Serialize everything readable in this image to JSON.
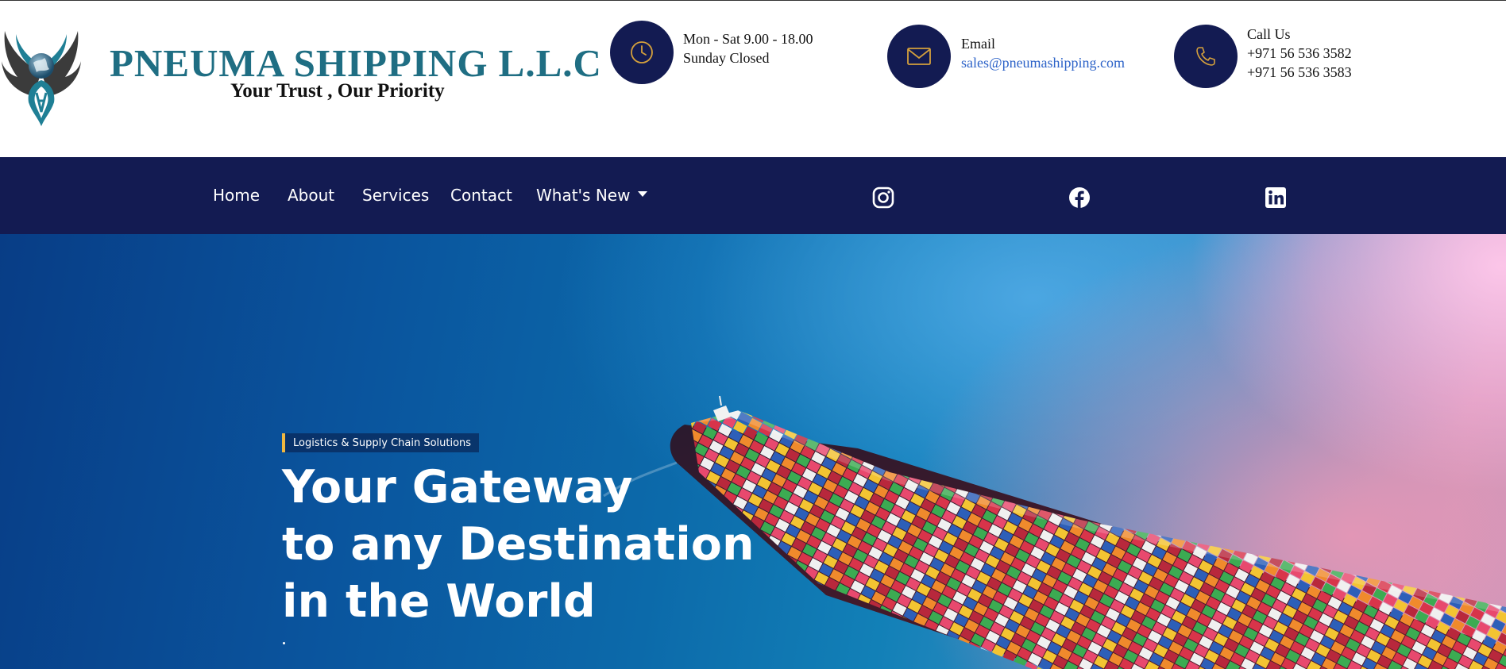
{
  "brand": {
    "name": "PNEUMA SHIPPING L.L.C",
    "tagline": "Your Trust , Our Priority"
  },
  "contact_info": {
    "hours": {
      "line1": "Mon - Sat 9.00 - 18.00",
      "line2": "Sunday Closed",
      "icon": "clock-icon"
    },
    "email": {
      "label": "Email",
      "address": "sales@pneumashipping.com",
      "icon": "mail-icon"
    },
    "phone": {
      "label": "Call Us",
      "number1": "+971 56 536 3582",
      "number2": "+971 56 536 3583",
      "icon": "phone-icon"
    }
  },
  "nav": {
    "items": [
      {
        "label": "Home"
      },
      {
        "label": "About"
      },
      {
        "label": "Services"
      },
      {
        "label": "Contact"
      },
      {
        "label": "What's New"
      }
    ],
    "social": [
      "instagram-icon",
      "facebook-icon",
      "linkedin-icon"
    ]
  },
  "hero": {
    "badge": "Logistics & Supply Chain Solutions",
    "title_line1": "Your Gateway",
    "title_line2": "to any Destination",
    "title_line3": "in the World"
  },
  "colors": {
    "navy": "#131b52",
    "accent_gold": "#f1b740",
    "brand_teal": "#1f6e83",
    "link_blue": "#2d63c8"
  }
}
